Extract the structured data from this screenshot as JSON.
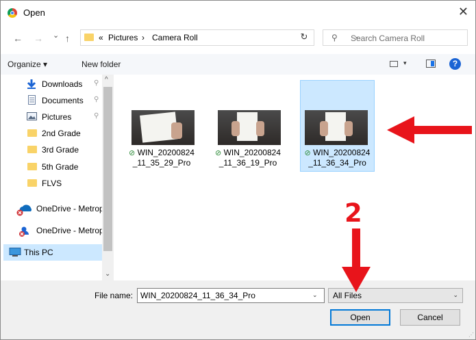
{
  "window": {
    "title": "Open",
    "close_glyph": "✕"
  },
  "nav": {
    "back_glyph": "←",
    "forward_glyph": "→",
    "recent_glyph": "⌄",
    "up_glyph": "↑",
    "breadcrumb_overflow": "«",
    "breadcrumb": [
      "Pictures",
      "Camera Roll"
    ],
    "separator": "›",
    "dropdown_glyph": "⌄",
    "refresh_glyph": "↻",
    "search_glyph": "⚲",
    "search_placeholder": "Search Camera Roll"
  },
  "toolbar": {
    "organize_label": "Organize ▾",
    "new_folder_label": "New folder",
    "view_drop_glyph": "▾",
    "help_label": "?"
  },
  "sidebar": {
    "pin_glyph": "⚲",
    "scroll_up_glyph": "^",
    "scroll_down_glyph": "⌄",
    "items": [
      {
        "label": "Downloads",
        "icon": "download-icon",
        "pinned": true
      },
      {
        "label": "Documents",
        "icon": "documents-icon",
        "pinned": true
      },
      {
        "label": "Pictures",
        "icon": "pictures-icon",
        "pinned": true
      },
      {
        "label": "2nd Grade",
        "icon": "folder-icon",
        "pinned": false
      },
      {
        "label": "3rd Grade",
        "icon": "folder-icon",
        "pinned": false
      },
      {
        "label": "5th Grade",
        "icon": "folder-icon",
        "pinned": false
      },
      {
        "label": "FLVS",
        "icon": "folder-icon",
        "pinned": false
      },
      {
        "label": "OneDrive - Metrop",
        "icon": "onedrive-error-icon",
        "pinned": false
      },
      {
        "label": "OneDrive - Metrop",
        "icon": "onedrive-shared-icon",
        "pinned": false
      },
      {
        "label": "This PC",
        "icon": "this-pc-icon",
        "pinned": false,
        "selected": true
      }
    ]
  },
  "files": {
    "sync_glyph": "⊘",
    "items": [
      {
        "line1": "WIN_20200824",
        "line2": "_11_35_29_Pro",
        "selected": false
      },
      {
        "line1": "WIN_20200824",
        "line2": "_11_36_19_Pro",
        "selected": false
      },
      {
        "line1": "WIN_20200824",
        "line2": "_11_36_34_Pro",
        "selected": true
      }
    ]
  },
  "footer": {
    "file_name_label": "File name:",
    "file_name_value": "WIN_20200824_11_36_34_Pro",
    "dropdown_glyph": "⌄",
    "file_type_value": "All Files",
    "open_label": "Open",
    "cancel_label": "Cancel",
    "grip_glyph": "⋰"
  },
  "annotations": {
    "step_number": "2",
    "arrow_color": "#e8141b"
  },
  "colors": {
    "selection": "#cce8ff",
    "accent": "#0078d7"
  }
}
